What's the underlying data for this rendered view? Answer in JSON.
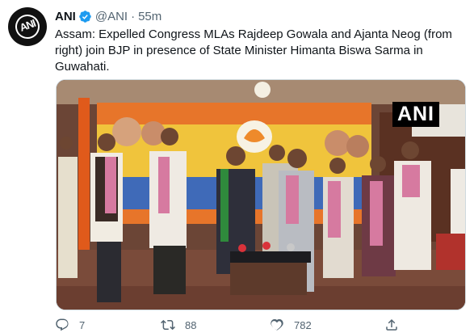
{
  "tweet": {
    "author_name": "ANI",
    "author_handle": "@ANI",
    "separator": "·",
    "time": "55m",
    "avatar_text": "ANI",
    "text": "Assam: Expelled Congress MLAs Rajdeep Gowala and Ajanta Neog (from right) join BJP in presence of State Minister Himanta Biswa Sarma in Guwahati.",
    "media_watermark": "ANI"
  },
  "actions": {
    "reply_count": "7",
    "retweet_count": "88",
    "like_count": "782"
  },
  "icons": {
    "verified": "verified-badge-icon",
    "reply": "reply-icon",
    "retweet": "retweet-icon",
    "like": "heart-icon",
    "share": "share-icon"
  },
  "colors": {
    "verified_blue": "#1d9bf0",
    "text_primary": "#0f1419",
    "text_secondary": "#536471"
  }
}
